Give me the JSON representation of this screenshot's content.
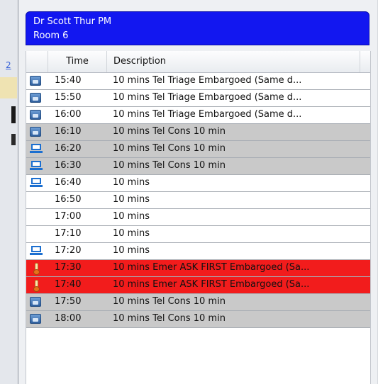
{
  "panel": {
    "header": {
      "name": "Dr Scott Thur PM",
      "room": "Room 6"
    },
    "columns": {
      "time": "Time",
      "description": "Description"
    },
    "rows": [
      {
        "icon": "phone-icon",
        "time": "15:40",
        "description": "10 mins Tel Triage  Embargoed (Same d...",
        "status": "white"
      },
      {
        "icon": "phone-icon",
        "time": "15:50",
        "description": "10 mins Tel Triage  Embargoed (Same d...",
        "status": "white"
      },
      {
        "icon": "phone-icon",
        "time": "16:00",
        "description": "10 mins Tel Triage  Embargoed (Same d...",
        "status": "white"
      },
      {
        "icon": "phone-icon",
        "time": "16:10",
        "description": "10 mins Tel Cons 10 min",
        "status": "grey"
      },
      {
        "icon": "laptop-icon",
        "time": "16:20",
        "description": "10 mins Tel Cons 10 min",
        "status": "grey"
      },
      {
        "icon": "laptop-icon",
        "time": "16:30",
        "description": "10 mins Tel Cons 10 min",
        "status": "grey"
      },
      {
        "icon": "laptop-icon",
        "time": "16:40",
        "description": "10 mins",
        "status": "white"
      },
      {
        "icon": "",
        "time": "16:50",
        "description": "10 mins",
        "status": "white"
      },
      {
        "icon": "",
        "time": "17:00",
        "description": "10 mins",
        "status": "white"
      },
      {
        "icon": "",
        "time": "17:10",
        "description": "10 mins",
        "status": "white"
      },
      {
        "icon": "laptop-icon",
        "time": "17:20",
        "description": "10 mins",
        "status": "white"
      },
      {
        "icon": "thermometer-icon",
        "time": "17:30",
        "description": "10 mins Emer ASK FIRST Embargoed (Sa...",
        "status": "red"
      },
      {
        "icon": "thermometer-icon",
        "time": "17:40",
        "description": "10 mins Emer ASK FIRST Embargoed (Sa...",
        "status": "red"
      },
      {
        "icon": "phone-icon",
        "time": "17:50",
        "description": "10 mins Tel Cons 10 min",
        "status": "grey"
      },
      {
        "icon": "phone-icon",
        "time": "18:00",
        "description": "10 mins Tel Cons 10 min",
        "status": "grey"
      }
    ]
  },
  "background": {
    "link_text": "2"
  },
  "colors": {
    "header": "#1217f0",
    "booked_grey": "#c9c9c9",
    "emergency_red": "#f21c1c",
    "free_white": "#ffffff"
  }
}
